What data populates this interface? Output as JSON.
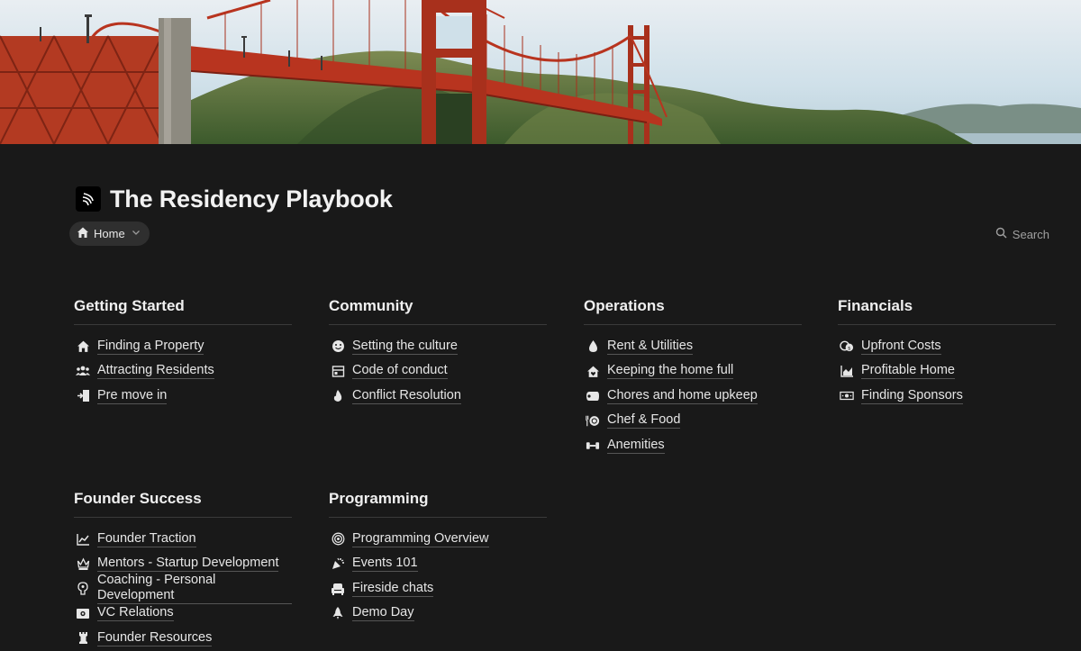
{
  "page": {
    "title": "The Residency Playbook",
    "breadcrumb_label": "Home",
    "search_label": "Search"
  },
  "colors": {
    "background": "#191919",
    "bridge": "#b8341f",
    "sky": "#cfe1ea"
  },
  "sections": [
    {
      "title": "Getting Started",
      "items": [
        {
          "label": "Finding a Property",
          "icon": "house-icon"
        },
        {
          "label": "Attracting Residents",
          "icon": "people-icon"
        },
        {
          "label": "Pre move in",
          "icon": "door-enter-icon"
        }
      ]
    },
    {
      "title": "Community",
      "items": [
        {
          "label": "Setting the culture",
          "icon": "smiley-icon"
        },
        {
          "label": "Code of conduct",
          "icon": "rulebook-icon"
        },
        {
          "label": "Conflict Resolution",
          "icon": "flame-icon"
        }
      ]
    },
    {
      "title": "Operations",
      "items": [
        {
          "label": "Rent & Utilities",
          "icon": "droplet-icon"
        },
        {
          "label": "Keeping the home full",
          "icon": "house-heart-icon"
        },
        {
          "label": "Chores and home upkeep",
          "icon": "toilet-paper-icon"
        },
        {
          "label": "Chef & Food",
          "icon": "plate-utensils-icon"
        },
        {
          "label": "Anemities",
          "icon": "dumbbell-icon"
        }
      ]
    },
    {
      "title": "Financials",
      "items": [
        {
          "label": "Upfront Costs",
          "icon": "coins-icon"
        },
        {
          "label": "Profitable Home",
          "icon": "area-chart-icon"
        },
        {
          "label": "Finding Sponsors",
          "icon": "money-bill-icon"
        }
      ]
    },
    {
      "title": "Founder Success",
      "items": [
        {
          "label": "Founder Traction",
          "icon": "line-chart-icon"
        },
        {
          "label": "Mentors - Startup Development",
          "icon": "crown-icon"
        },
        {
          "label": "Coaching - Personal Development",
          "icon": "brain-icon"
        },
        {
          "label": "VC Relations",
          "icon": "cash-icon"
        },
        {
          "label": "Founder Resources",
          "icon": "chess-rook-icon"
        }
      ]
    },
    {
      "title": "Programming",
      "items": [
        {
          "label": "Programming Overview",
          "icon": "target-icon"
        },
        {
          "label": "Events 101",
          "icon": "party-icon"
        },
        {
          "label": "Fireside chats",
          "icon": "armchair-icon"
        },
        {
          "label": "Demo Day",
          "icon": "rocket-icon"
        }
      ]
    }
  ]
}
